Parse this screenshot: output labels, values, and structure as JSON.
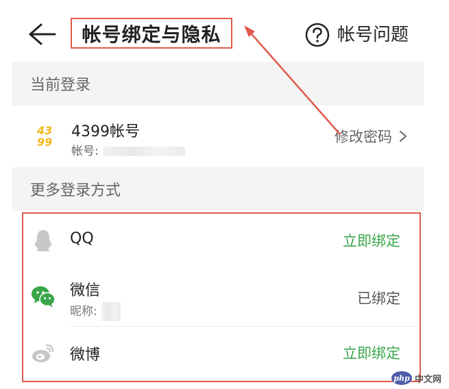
{
  "header": {
    "title": "帐号绑定与隐私",
    "help_label": "帐号问题"
  },
  "current_login": {
    "section_label": "当前登录",
    "account_name": "4399帐号",
    "account_prefix": "帐号:",
    "logo_text_top": "43",
    "logo_text_bottom": "99",
    "change_password": "修改密码"
  },
  "more_login": {
    "section_label": "更多登录方式",
    "items": [
      {
        "name": "QQ",
        "action": "立即绑定",
        "status": "unbound"
      },
      {
        "name": "微信",
        "sub_prefix": "昵称:",
        "action": "已绑定",
        "status": "bound"
      },
      {
        "name": "微博",
        "action": "立即绑定",
        "status": "unbound"
      }
    ]
  },
  "watermark": {
    "logo": "php",
    "text": "中文网"
  },
  "colors": {
    "accent_green": "#3aa64a",
    "annotation_red": "#e05a4a",
    "logo_yellow": "#f2b81c",
    "section_bg": "#f4f4f4"
  }
}
